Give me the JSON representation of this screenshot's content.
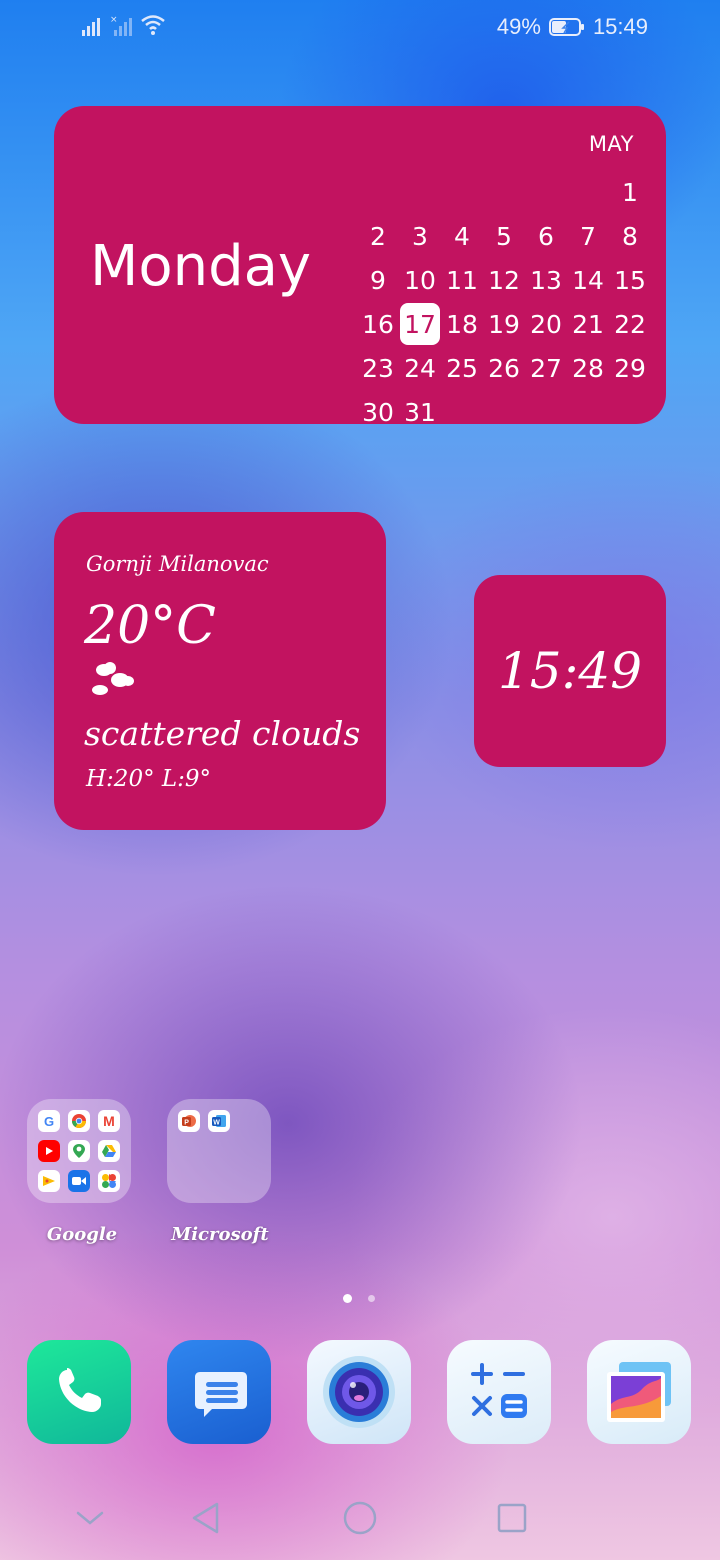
{
  "status_bar": {
    "battery_percent": "49%",
    "time": "15:49"
  },
  "calendar_widget": {
    "day_name": "Monday",
    "month": "MAY",
    "today": "17",
    "days": [
      "",
      "",
      "",
      "",
      "",
      "",
      "1",
      "2",
      "3",
      "4",
      "5",
      "6",
      "7",
      "8",
      "9",
      "10",
      "11",
      "12",
      "13",
      "14",
      "15",
      "16",
      "17",
      "18",
      "19",
      "20",
      "21",
      "22",
      "23",
      "24",
      "25",
      "26",
      "27",
      "28",
      "29",
      "30",
      "31",
      "",
      "",
      "",
      "",
      ""
    ]
  },
  "weather_widget": {
    "city": "Gornji Milanovac",
    "temperature": "20°C",
    "icon": "cloud-icon",
    "description": "scattered clouds",
    "high_low": "H:20° L:9°"
  },
  "clock_widget": {
    "time": "15:49"
  },
  "folders": [
    {
      "label": "Google",
      "apps": [
        "google",
        "chrome",
        "gmail",
        "youtube",
        "maps",
        "drive",
        "play-games",
        "meet",
        "photos"
      ]
    },
    {
      "label": "Microsoft",
      "apps": [
        "powerpoint",
        "word"
      ]
    }
  ],
  "page_indicator": {
    "count": 2,
    "active": 1
  },
  "dock": [
    {
      "name": "phone-icon",
      "color": "#14c98a"
    },
    {
      "name": "messages-icon",
      "color": "#1a73e8"
    },
    {
      "name": "camera-icon",
      "color": "#d8ecfb"
    },
    {
      "name": "calculator-icon",
      "color": "#e9f3fb"
    },
    {
      "name": "gallery-icon",
      "color": "#e6f2fb"
    }
  ],
  "colors": {
    "widget_background": "#c21360",
    "accent": "#ffffff"
  }
}
